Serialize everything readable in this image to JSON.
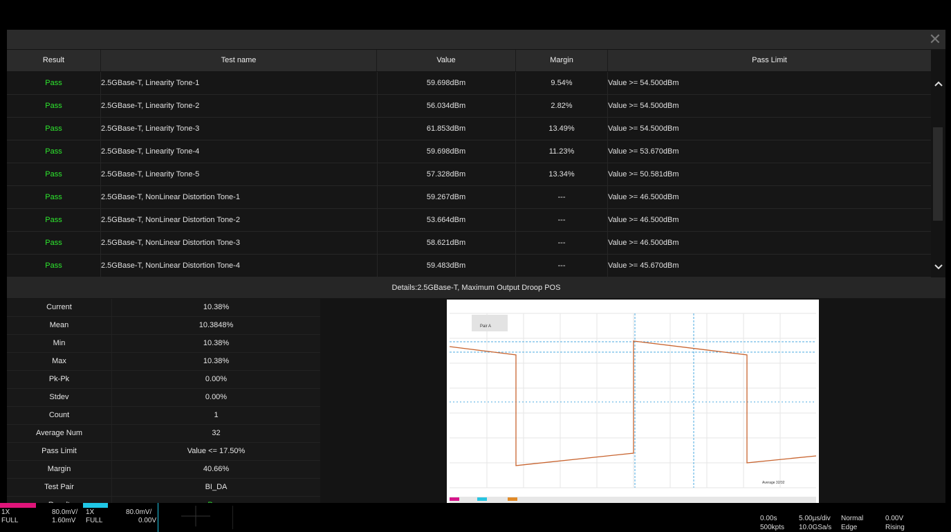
{
  "header": {
    "result": "Result",
    "test_name": "Test name",
    "value": "Value",
    "margin": "Margin",
    "pass_limit": "Pass Limit"
  },
  "close_label": "✕",
  "rows": [
    {
      "result": "Pass",
      "name": "2.5GBase-T, Linearity Tone-1",
      "value": "59.698dBm",
      "margin": "9.54%",
      "limit": "Value >= 54.500dBm"
    },
    {
      "result": "Pass",
      "name": "2.5GBase-T, Linearity Tone-2",
      "value": "56.034dBm",
      "margin": "2.82%",
      "limit": "Value >= 54.500dBm"
    },
    {
      "result": "Pass",
      "name": "2.5GBase-T, Linearity Tone-3",
      "value": "61.853dBm",
      "margin": "13.49%",
      "limit": "Value >= 54.500dBm"
    },
    {
      "result": "Pass",
      "name": "2.5GBase-T, Linearity Tone-4",
      "value": "59.698dBm",
      "margin": "11.23%",
      "limit": "Value >= 53.670dBm"
    },
    {
      "result": "Pass",
      "name": "2.5GBase-T, Linearity Tone-5",
      "value": "57.328dBm",
      "margin": "13.34%",
      "limit": "Value >= 50.581dBm"
    },
    {
      "result": "Pass",
      "name": "2.5GBase-T, NonLinear Distortion Tone-1",
      "value": "59.267dBm",
      "margin": "---",
      "limit": "Value >= 46.500dBm"
    },
    {
      "result": "Pass",
      "name": "2.5GBase-T, NonLinear Distortion Tone-2",
      "value": "53.664dBm",
      "margin": "---",
      "limit": "Value >= 46.500dBm"
    },
    {
      "result": "Pass",
      "name": "2.5GBase-T, NonLinear Distortion Tone-3",
      "value": "58.621dBm",
      "margin": "---",
      "limit": "Value >= 46.500dBm"
    },
    {
      "result": "Pass",
      "name": "2.5GBase-T, NonLinear Distortion Tone-4",
      "value": "59.483dBm",
      "margin": "---",
      "limit": "Value >= 45.670dBm"
    }
  ],
  "details_title": "Details:2.5GBase-T, Maximum Output Droop POS",
  "stats": [
    {
      "k": "Current",
      "v": "10.38%"
    },
    {
      "k": "Mean",
      "v": "10.3848%"
    },
    {
      "k": "Min",
      "v": "10.38%"
    },
    {
      "k": "Max",
      "v": "10.38%"
    },
    {
      "k": "Pk-Pk",
      "v": "0.00%"
    },
    {
      "k": "Stdev",
      "v": "0.00%"
    },
    {
      "k": "Count",
      "v": "1"
    },
    {
      "k": "Average Num",
      "v": "32"
    },
    {
      "k": "Pass Limit",
      "v": "Value <= 17.50%"
    },
    {
      "k": "Margin",
      "v": "40.66%"
    },
    {
      "k": "Test Pair",
      "v": "BI_DA"
    },
    {
      "k": "Result",
      "v": "Pass"
    }
  ],
  "waveform": {
    "pair_label": "Pair A",
    "footer_label": "Average 32/32"
  },
  "status": {
    "ch1": {
      "probe": "1X",
      "scale": "80.0mV/",
      "coupling": "FULL",
      "offset": "1.60mV",
      "color": "#e0147a"
    },
    "ch2": {
      "probe": "1X",
      "scale": "80.0mV/",
      "coupling": "FULL",
      "offset": "0.00V",
      "color": "#1fc7e6"
    },
    "timebase": {
      "delay": "0.00s",
      "scale": "5.00µs/div",
      "points": "500kpts",
      "rate": "10.0GSa/s"
    },
    "trigger": {
      "mode": "Normal",
      "type": "Edge",
      "level": "0.00V",
      "slope": "Rising"
    }
  }
}
